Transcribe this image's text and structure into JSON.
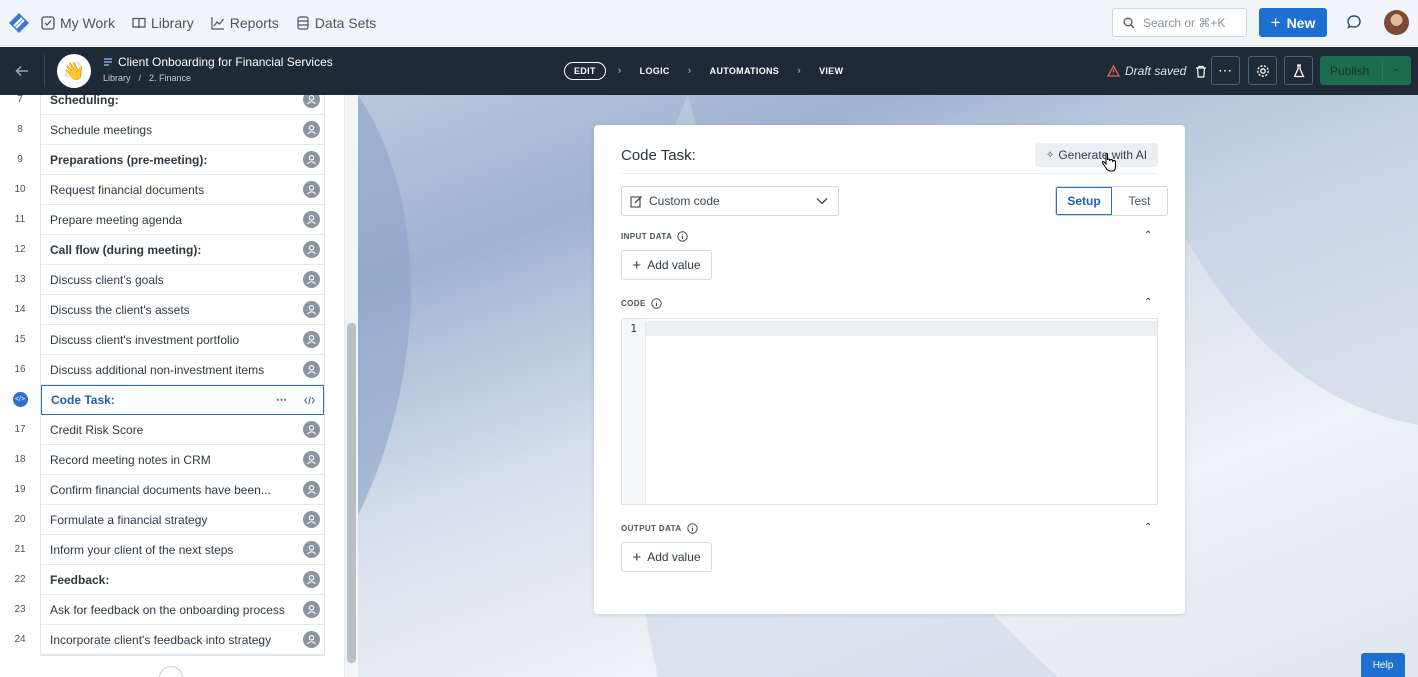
{
  "topnav": {
    "links": [
      {
        "label": "My Work",
        "icon": "checkbox-icon"
      },
      {
        "label": "Library",
        "icon": "book-icon"
      },
      {
        "label": "Reports",
        "icon": "chart-icon"
      },
      {
        "label": "Data Sets",
        "icon": "database-icon"
      }
    ],
    "search_placeholder": "Search or ⌘+K",
    "new_label": "New"
  },
  "header": {
    "workflow_title": "Client Onboarding for Financial Services",
    "crumb_library": "Library",
    "crumb_sep": "/",
    "crumb_folder": "2. Finance",
    "steps": [
      "EDIT",
      "LOGIC",
      "AUTOMATIONS",
      "VIEW"
    ],
    "status": "Draft saved",
    "publish_label": "Publish"
  },
  "sidebar": {
    "rows": [
      {
        "num": "7",
        "label": "Scheduling:",
        "bold": true
      },
      {
        "num": "8",
        "label": "Schedule meetings",
        "bold": false
      },
      {
        "num": "9",
        "label": "Preparations (pre-meeting):",
        "bold": true
      },
      {
        "num": "10",
        "label": "Request financial documents",
        "bold": false
      },
      {
        "num": "11",
        "label": "Prepare meeting agenda",
        "bold": false
      },
      {
        "num": "12",
        "label": "Call flow (during meeting):",
        "bold": true
      },
      {
        "num": "13",
        "label": "Discuss client's goals",
        "bold": false
      },
      {
        "num": "14",
        "label": "Discuss the client's assets",
        "bold": false
      },
      {
        "num": "15",
        "label": "Discuss client's investment portfolio",
        "bold": false
      },
      {
        "num": "16",
        "label": "Discuss additional non-investment items",
        "bold": false
      },
      {
        "num": "",
        "label": "Code Task:",
        "bold": true,
        "active": true
      },
      {
        "num": "17",
        "label": "Credit Risk Score",
        "bold": false
      },
      {
        "num": "18",
        "label": "Record meeting notes in CRM",
        "bold": false
      },
      {
        "num": "19",
        "label": "Confirm financial documents have been...",
        "bold": false
      },
      {
        "num": "20",
        "label": "Formulate a financial strategy",
        "bold": false
      },
      {
        "num": "21",
        "label": "Inform your client of the next steps",
        "bold": false
      },
      {
        "num": "22",
        "label": "Feedback:",
        "bold": true
      },
      {
        "num": "23",
        "label": "Ask for feedback on the onboarding process",
        "bold": false
      },
      {
        "num": "24",
        "label": "Incorporate client's feedback into strategy",
        "bold": false
      }
    ]
  },
  "card": {
    "title": "Code Task:",
    "generate_label": "Generate with AI",
    "select_value": "Custom code",
    "tab_setup": "Setup",
    "tab_test": "Test",
    "input_label": "INPUT DATA",
    "code_label": "CODE",
    "output_label": "OUTPUT DATA",
    "add_value_label": "Add value",
    "editor_line": "1"
  },
  "help_label": "Help",
  "colors": {
    "accent": "#1d6fd1",
    "header_bg": "#1f2a37",
    "publish": "#1b6d4e"
  }
}
